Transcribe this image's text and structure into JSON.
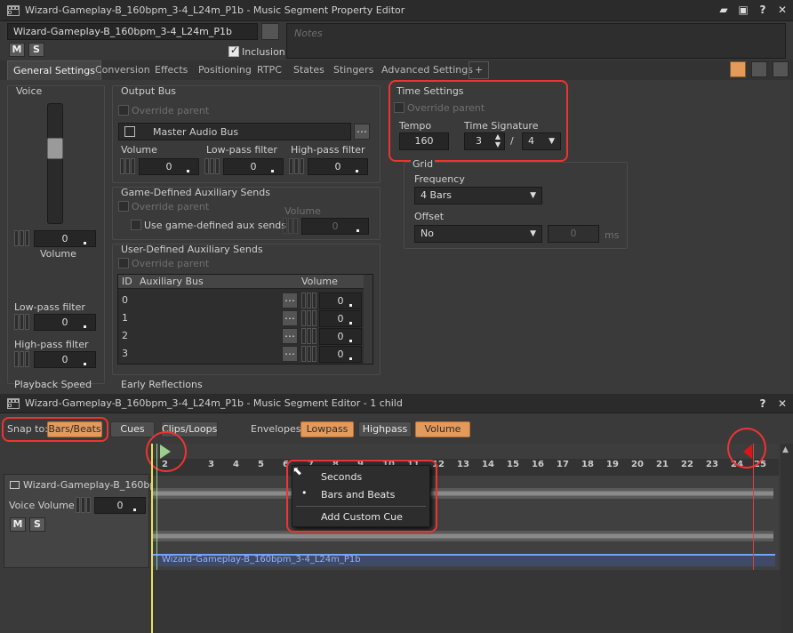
{
  "property_editor": {
    "title": "Wizard-Gameplay-B_160bpm_3-4_L24m_P1b - Music Segment Property Editor",
    "name_value": "Wizard-Gameplay-B_160bpm_3-4_L24m_P1b",
    "notes_placeholder": "Notes",
    "mute": "M",
    "solo": "S",
    "inclusion": "Inclusion",
    "tabs": [
      "General Settings",
      "Conversion",
      "Effects",
      "Positioning",
      "RTPC",
      "States",
      "Stingers",
      "Advanced Settings",
      "+"
    ],
    "voice": {
      "title": "Voice",
      "volume_value": "0",
      "volume_label": "Volume",
      "lowpass_label": "Low-pass filter",
      "lowpass_value": "0",
      "highpass_label": "High-pass filter",
      "highpass_value": "0",
      "playback_label": "Playback Speed"
    },
    "output_bus": {
      "title": "Output Bus",
      "override": "Override parent",
      "bus_name": "Master Audio Bus",
      "volume_label": "Volume",
      "volume_value": "0",
      "lowpass_label": "Low-pass filter",
      "lowpass_value": "0",
      "highpass_label": "High-pass filter",
      "highpass_value": "0"
    },
    "game_aux": {
      "title": "Game-Defined Auxiliary Sends",
      "override": "Override parent",
      "use_label": "Use game-defined aux sends",
      "volume_label": "Volume",
      "volume_value": "0"
    },
    "user_aux": {
      "title": "User-Defined Auxiliary Sends",
      "override": "Override parent",
      "col_id": "ID",
      "col_bus": "Auxiliary Bus",
      "col_volume": "Volume",
      "rows": [
        {
          "id": "0",
          "value": "0"
        },
        {
          "id": "1",
          "value": "0"
        },
        {
          "id": "2",
          "value": "0"
        },
        {
          "id": "3",
          "value": "0"
        }
      ]
    },
    "early_reflections": "Early Reflections",
    "time_settings": {
      "title": "Time Settings",
      "override": "Override parent",
      "tempo_label": "Tempo",
      "tempo_value": "160",
      "sig_label": "Time Signature",
      "sig_num": "3",
      "sig_sep": "/",
      "sig_den": "4"
    },
    "grid": {
      "title": "Grid",
      "frequency_label": "Frequency",
      "frequency_value": "4 Bars",
      "offset_label": "Offset",
      "offset_value": "No",
      "offset_num": "0",
      "offset_unit": "ms"
    }
  },
  "segment_editor": {
    "title": "Wizard-Gameplay-B_160bpm_3-4_L24m_P1b - Music Segment Editor - 1 child",
    "snap_label": "Snap to:",
    "snap_bars": "Bars/Beats",
    "snap_cues": "Cues",
    "snap_clips": "Clips/Loops",
    "envelopes_label": "Envelopes:",
    "env_lowpass": "Lowpass",
    "env_highpass": "Highpass",
    "env_volume": "Volume",
    "ruler": [
      "2",
      "3",
      "4",
      "5",
      "6",
      "7",
      "8",
      "9",
      "10",
      "11",
      "12",
      "13",
      "14",
      "15",
      "16",
      "17",
      "18",
      "19",
      "20",
      "21",
      "22",
      "23",
      "24",
      "25"
    ],
    "track_name": "Wizard-Gameplay-B_160bp...",
    "voice_volume_label": "Voice Volume",
    "voice_volume_value": "0",
    "clip_name": "Wizard-Gameplay-B_160bpm_3-4_L24m_P1b",
    "context_menu": [
      "Seconds",
      "Bars and Beats",
      "Add Custom Cue"
    ],
    "context_selected": "•"
  }
}
